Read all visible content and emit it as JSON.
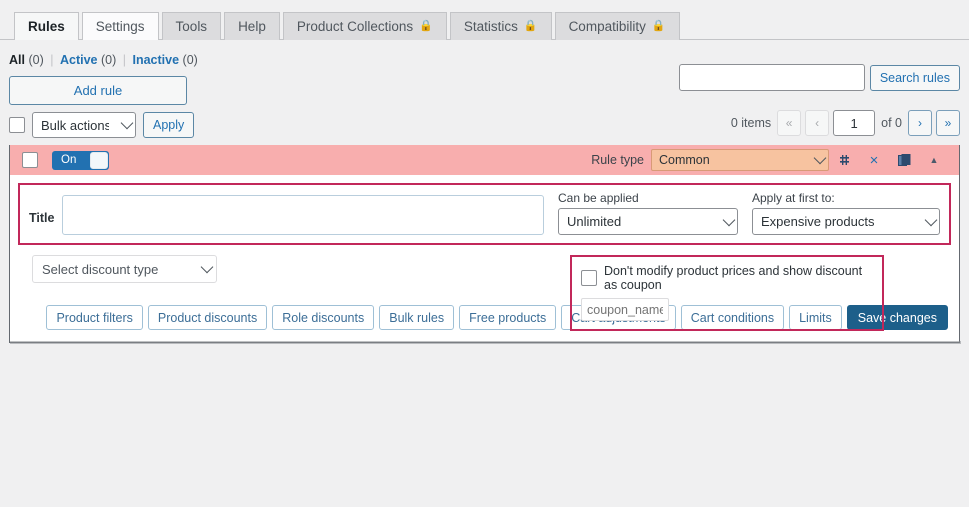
{
  "tabs": [
    {
      "label": "Rules",
      "locked": false,
      "active": true,
      "style": "active"
    },
    {
      "label": "Settings",
      "locked": false,
      "active": false,
      "style": "light"
    },
    {
      "label": "Tools",
      "locked": false,
      "active": false,
      "style": "dim"
    },
    {
      "label": "Help",
      "locked": false,
      "active": false,
      "style": "dim"
    },
    {
      "label": "Product Collections",
      "locked": true,
      "active": false,
      "style": "dim"
    },
    {
      "label": "Statistics",
      "locked": true,
      "active": false,
      "style": "dim"
    },
    {
      "label": "Compatibility",
      "locked": true,
      "active": false,
      "style": "dim"
    }
  ],
  "lock_icon": "lock-icon",
  "lock_glyph": "🔒",
  "filters": {
    "all_label": "All",
    "all_count": "(0)",
    "active_label": "Active",
    "active_count": "(0)",
    "inactive_label": "Inactive",
    "inactive_count": "(0)",
    "separator": "|"
  },
  "add_rule_label": "Add rule",
  "bulk": {
    "selected": "Bulk actions",
    "options": [
      "Bulk actions"
    ],
    "apply_label": "Apply"
  },
  "search": {
    "value": "",
    "placeholder": "",
    "button_label": "Search rules"
  },
  "pager": {
    "items_text": "0 items",
    "first_label": "«",
    "prev_label": "‹",
    "current_page": "1",
    "of_text": "of 0",
    "next_label": "›",
    "last_label": "»"
  },
  "rule": {
    "toggle_label": "On",
    "rule_type_label": "Rule type",
    "rule_type_selected": "Common",
    "rule_type_options": [
      "Common"
    ],
    "icons": {
      "drag": "drag-handle-icon",
      "drag_glyph": "⌗",
      "close": "close-icon",
      "close_glyph": "×",
      "duplicate": "duplicate-icon",
      "collapse": "collapse-chevron-icon",
      "collapse_glyph": "▲"
    },
    "title_label": "Title",
    "title_value": "",
    "title_placeholder": "",
    "can_be_applied": {
      "caption": "Can be applied",
      "selected": "Unlimited",
      "options": [
        "Unlimited"
      ]
    },
    "apply_at_first_to": {
      "caption": "Apply at first to:",
      "selected": "Expensive products",
      "options": [
        "Expensive products"
      ]
    },
    "discount_type": {
      "selected": "Select discount type",
      "options": [
        "Select discount type"
      ]
    },
    "coupon": {
      "checkbox_checked": false,
      "label": "Don't modify product prices and show discount as coupon",
      "name_value": "",
      "name_placeholder": "coupon_name"
    },
    "buttons": [
      "Product filters",
      "Product discounts",
      "Role discounts",
      "Bulk rules",
      "Free products",
      "Cart adjustments",
      "Cart conditions",
      "Limits"
    ],
    "save_label": "Save changes"
  },
  "colors": {
    "page_bg": "#f0f0f1",
    "rule_header_pink": "#f8aeae",
    "highlight_border": "#c2285a",
    "toggle_blue": "#2271b1",
    "rule_type_peach": "#f7c3a0",
    "save_blue": "#1d5f8a",
    "link_blue": "#2271b1",
    "lock_orange": "#e8a33d"
  }
}
